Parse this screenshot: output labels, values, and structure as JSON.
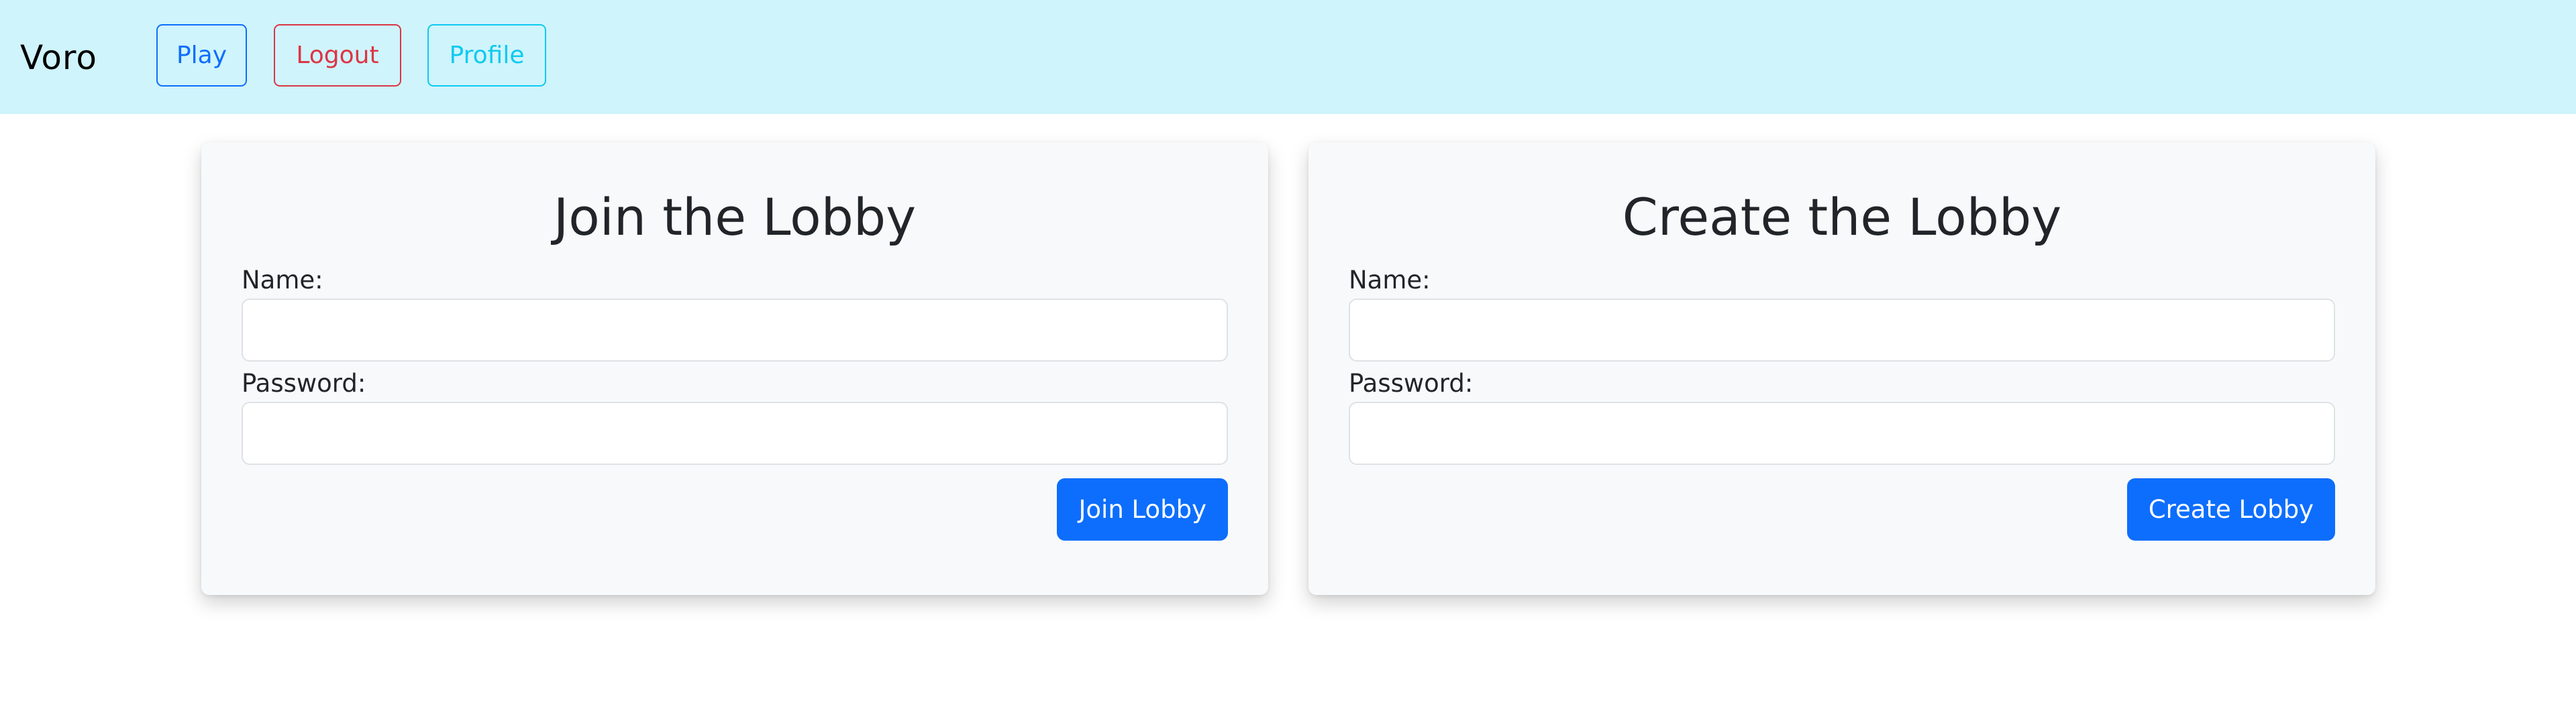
{
  "navbar": {
    "brand": "Voro",
    "buttons": {
      "play": "Play",
      "logout": "Logout",
      "profile": "Profile"
    },
    "colors": {
      "background": "#cff4fc",
      "play": "#0d6efd",
      "logout": "#dc3545",
      "profile": "#0dcaf0"
    }
  },
  "join": {
    "title": "Join the Lobby",
    "name_label": "Name:",
    "name_value": "",
    "password_label": "Password:",
    "password_value": "",
    "submit_label": "Join Lobby"
  },
  "create": {
    "title": "Create the Lobby",
    "name_label": "Name:",
    "name_value": "",
    "password_label": "Password:",
    "password_value": "",
    "submit_label": "Create Lobby"
  },
  "theme": {
    "primary": "#0d6efd",
    "card_background": "#f8f9fa"
  }
}
